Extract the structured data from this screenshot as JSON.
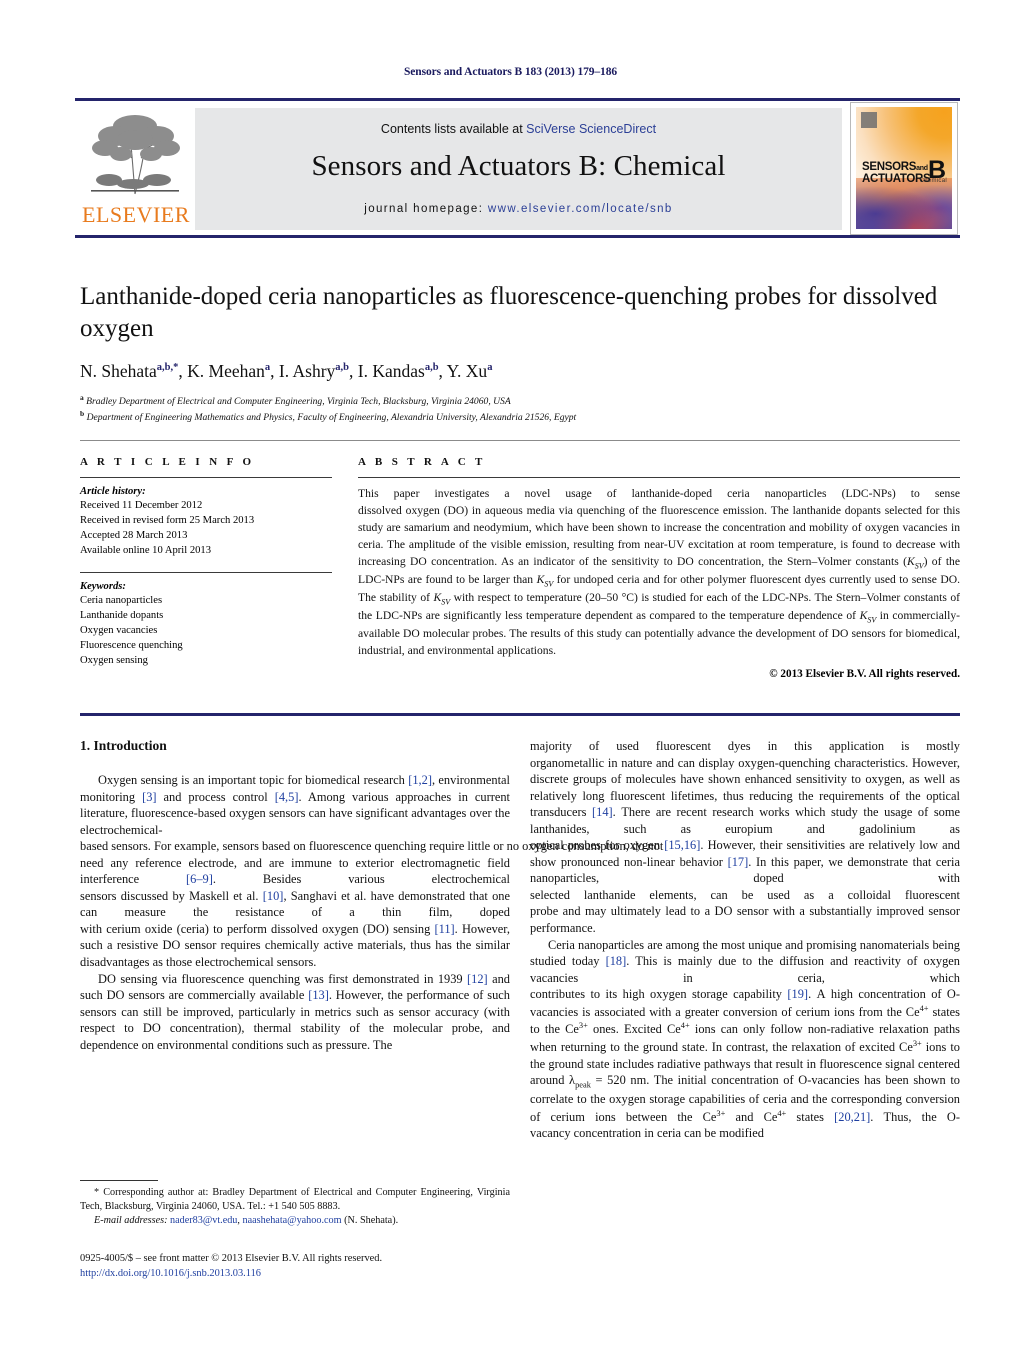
{
  "running_head": "Sensors and Actuators B 183 (2013) 179–186",
  "masthead": {
    "contents_prefix": "Contents lists available at ",
    "contents_link": "SciVerse ScienceDirect",
    "journal_title": "Sensors and Actuators B: Chemical",
    "homepage_prefix": "journal homepage: ",
    "homepage_url": "www.elsevier.com/locate/snb",
    "publisher_name": "ELSEVIER",
    "cover": {
      "line1": "SENSORS",
      "and": "and",
      "line2": "ACTUATORS",
      "letter": "B",
      "sub": "Chemical"
    }
  },
  "article": {
    "title": "Lanthanide-doped ceria nanoparticles as fluorescence-quenching probes for dissolved oxygen",
    "authors": [
      {
        "name": "N. Shehata",
        "marks": "a,b,*"
      },
      {
        "name": "K. Meehan",
        "marks": "a"
      },
      {
        "name": "I. Ashry",
        "marks": "a,b"
      },
      {
        "name": "I. Kandas",
        "marks": "a,b"
      },
      {
        "name": "Y. Xu",
        "marks": "a"
      }
    ],
    "affiliations": [
      {
        "mark": "a",
        "text": "Bradley Department of Electrical and Computer Engineering, Virginia Tech, Blacksburg, Virginia 24060, USA"
      },
      {
        "mark": "b",
        "text": "Department of Engineering Mathematics and Physics, Faculty of Engineering, Alexandria University, Alexandria 21526, Egypt"
      }
    ]
  },
  "article_info": {
    "heading": "A R T I C L E   I N F O",
    "history_label": "Article history:",
    "history": [
      "Received 11 December 2012",
      "Received in revised form 25 March 2013",
      "Accepted 28 March 2013",
      "Available online 10 April 2013"
    ],
    "keywords_label": "Keywords:",
    "keywords": [
      "Ceria nanoparticles",
      "Lanthanide dopants",
      "Oxygen vacancies",
      "Fluorescence quenching",
      "Oxygen sensing"
    ]
  },
  "abstract": {
    "heading": "A B S T R A C T",
    "copyright": "© 2013 Elsevier B.V. All rights reserved."
  },
  "intro": {
    "heading": "1.  Introduction"
  },
  "footnote": {
    "corresponding_label": "* Corresponding author at: ",
    "corresponding_text": "Bradley Department of Electrical and Computer Engineering, Virginia Tech, Blacksburg, Virginia 24060, USA. Tel.: +1 540 505 8883.",
    "email_label": "E-mail addresses:",
    "email1": "nader83@vt.edu",
    "email2": "naashehata@yahoo.com",
    "email_owner": "(N. Shehata)."
  },
  "issn": {
    "line": "0925-4005/$ – see front matter © 2013 Elsevier B.V. All rights reserved.",
    "doi": "http://dx.doi.org/10.1016/j.snb.2013.03.116"
  }
}
